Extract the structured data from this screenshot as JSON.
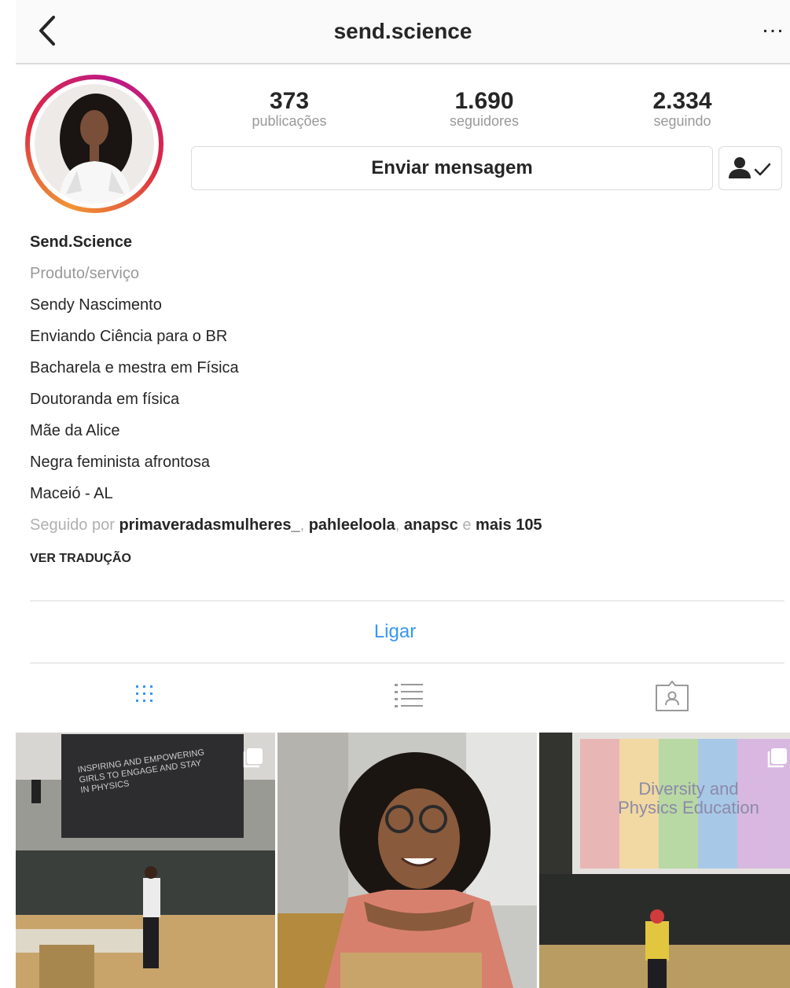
{
  "header": {
    "username": "send.science",
    "back_icon": "chevron-left-icon",
    "more_label": "…"
  },
  "profile": {
    "avatar_icon": "profile-avatar",
    "stats": [
      {
        "value": "373",
        "label": "publicações"
      },
      {
        "value": "1.690",
        "label": "seguidores"
      },
      {
        "value": "2.334",
        "label": "seguindo"
      }
    ],
    "message_button": "Enviar mensagem",
    "following_icon": "person-check-icon"
  },
  "bio": {
    "name": "Send.Science",
    "category": "Produto/serviço",
    "lines": [
      "Sendy Nascimento",
      "Enviando Ciência para o BR",
      "Bacharela e mestra em Física",
      "Doutoranda em física",
      "Mãe da Alice",
      "Negra feminista afrontosa",
      "Maceió - AL"
    ],
    "followed_by": {
      "prefix": "Seguido por",
      "user1": "primaveradasmulheres_",
      "sep1": ",",
      "user2": "pahleeloola",
      "sep2": ",",
      "user3": "anapsc",
      "conj": "e",
      "more": "mais 105"
    },
    "translate": "VER TRADUÇÃO"
  },
  "contact": {
    "call_label": "Ligar"
  },
  "tabs": [
    {
      "name": "grid",
      "icon": "grid-icon",
      "active": true
    },
    {
      "name": "list",
      "icon": "list-icon",
      "active": false
    },
    {
      "name": "tagged",
      "icon": "tagged-icon",
      "active": false
    }
  ],
  "posts": [
    {
      "slide_text": "INSPIRING AND EMPOWERING GIRLS TO ENGAGE AND STAY IN PHYSICS",
      "multi": true
    },
    {
      "multi": false
    },
    {
      "slide_text": "Diversity and Physics Education",
      "multi": true
    }
  ],
  "colors": {
    "link_blue": "#3897f0",
    "muted_gray": "#999999",
    "border": "#dbdbdb"
  }
}
